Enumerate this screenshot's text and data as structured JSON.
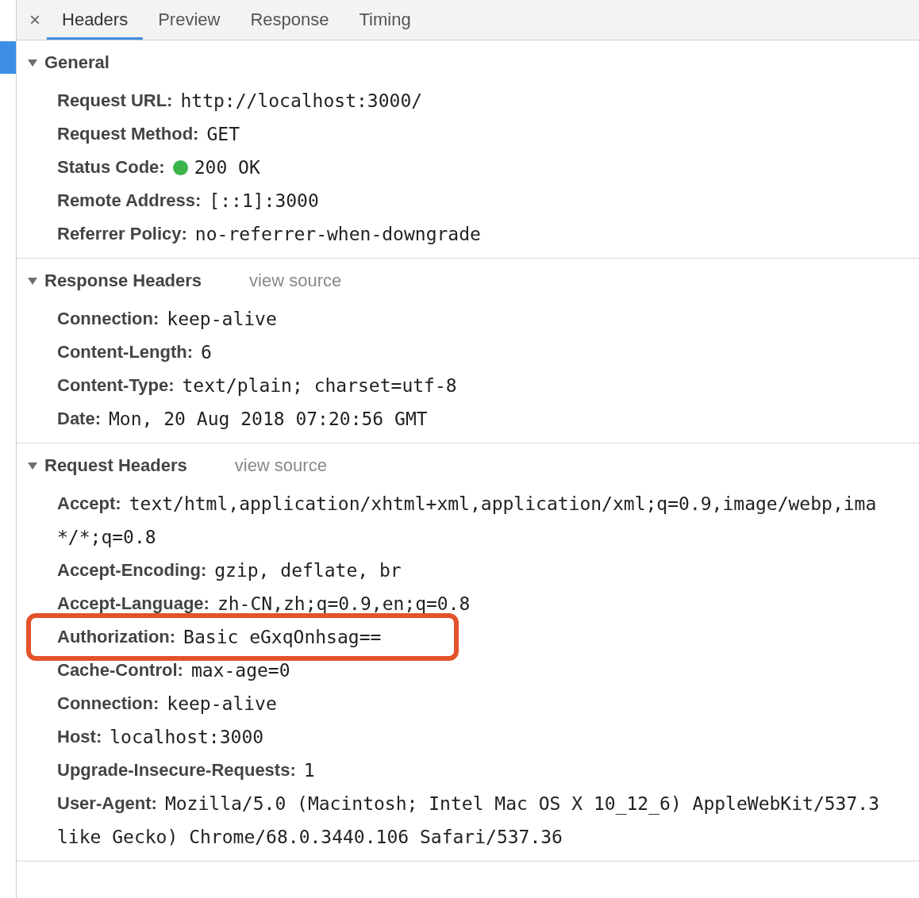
{
  "close_symbol": "×",
  "tabs": [
    {
      "label": "Headers",
      "selected": true
    },
    {
      "label": "Preview",
      "selected": false
    },
    {
      "label": "Response",
      "selected": false
    },
    {
      "label": "Timing",
      "selected": false
    }
  ],
  "sections": [
    {
      "title": "General",
      "expanded": true,
      "headers": [
        {
          "name": "Request URL:",
          "lines": [
            "http://localhost:3000/"
          ],
          "highlighted": false
        },
        {
          "name": "Request Method:",
          "lines": [
            "GET"
          ],
          "highlighted": false
        },
        {
          "name": "Status Code:",
          "lines": [
            "200 OK"
          ],
          "kind": "status",
          "highlighted": false
        },
        {
          "name": "Remote Address:",
          "lines": [
            "[::1]:3000"
          ],
          "highlighted": false
        },
        {
          "name": "Referrer Policy:",
          "lines": [
            "no-referrer-when-downgrade"
          ],
          "highlighted": false
        }
      ]
    },
    {
      "title": "Response Headers",
      "link": "view source",
      "expanded": true,
      "headers": [
        {
          "name": "Connection:",
          "lines": [
            "keep-alive"
          ],
          "highlighted": false
        },
        {
          "name": "Content-Length:",
          "lines": [
            "6"
          ],
          "highlighted": false
        },
        {
          "name": "Content-Type:",
          "lines": [
            "text/plain; charset=utf-8"
          ],
          "highlighted": false
        },
        {
          "name": "Date:",
          "lines": [
            "Mon, 20 Aug 2018 07:20:56 GMT"
          ],
          "highlighted": false
        }
      ]
    },
    {
      "title": "Request Headers",
      "link": "view source",
      "expanded": true,
      "headers": [
        {
          "name": "Accept:",
          "lines": [
            "text/html,application/xhtml+xml,application/xml;q=0.9,image/webp,ima",
            "*/*;q=0.8"
          ],
          "highlighted": false
        },
        {
          "name": "Accept-Encoding:",
          "lines": [
            "gzip, deflate, br"
          ],
          "highlighted": false
        },
        {
          "name": "Accept-Language:",
          "lines": [
            "zh-CN,zh;q=0.9,en;q=0.8"
          ],
          "highlighted": false
        },
        {
          "name": "Authorization:",
          "lines": [
            "Basic eGxqOnhsag=="
          ],
          "highlighted": true
        },
        {
          "name": "Cache-Control:",
          "lines": [
            "max-age=0"
          ],
          "highlighted": false
        },
        {
          "name": "Connection:",
          "lines": [
            "keep-alive"
          ],
          "highlighted": false
        },
        {
          "name": "Host:",
          "lines": [
            "localhost:3000"
          ],
          "highlighted": false
        },
        {
          "name": "Upgrade-Insecure-Requests:",
          "lines": [
            "1"
          ],
          "highlighted": false
        },
        {
          "name": "User-Agent:",
          "lines": [
            "Mozilla/5.0 (Macintosh; Intel Mac OS X 10_12_6) AppleWebKit/537.3",
            "like Gecko) Chrome/68.0.3440.106 Safari/537.36"
          ],
          "highlighted": false
        }
      ]
    }
  ]
}
